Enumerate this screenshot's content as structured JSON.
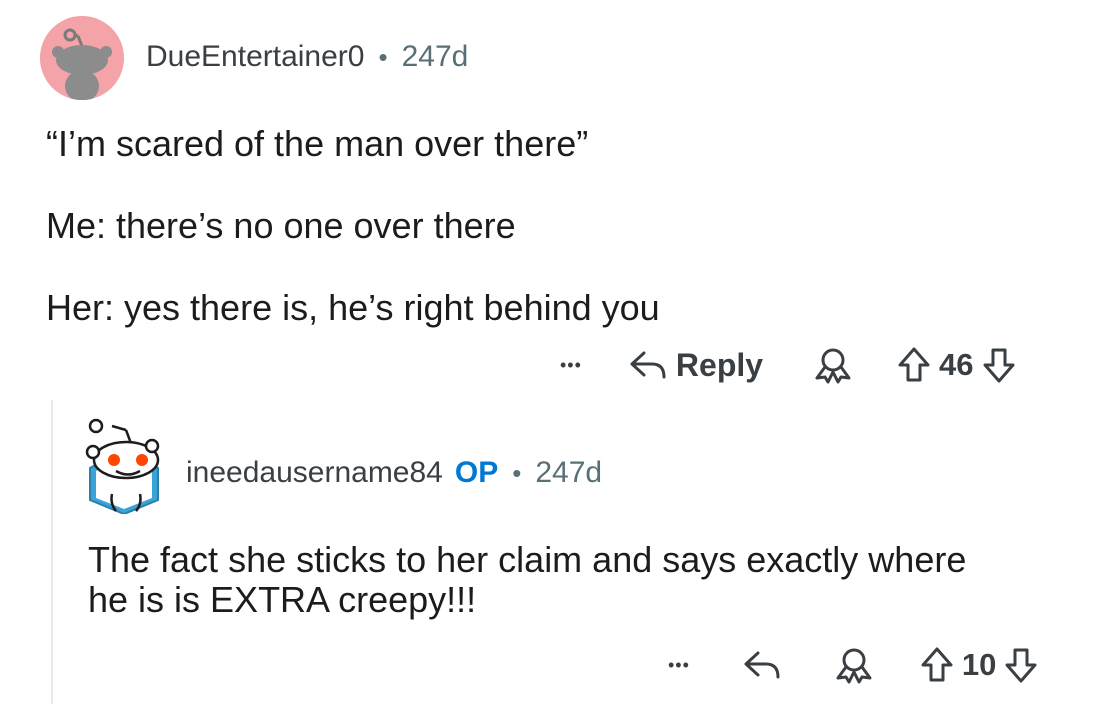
{
  "comments": [
    {
      "username": "DueEntertainer0",
      "separator": "•",
      "age": "247d",
      "body": [
        "“I’m scared of the man over there”",
        "Me: there’s no one over there",
        "Her: yes there is, he’s right behind you"
      ],
      "actions": {
        "more": "•••",
        "reply_label": "Reply",
        "score": "46"
      },
      "avatar": {
        "bg": "#f4a3a8",
        "icon": "snoo-avatar-icon"
      }
    },
    {
      "username": "ineedausername84",
      "op_badge": "OP",
      "separator": "•",
      "age": "247d",
      "body": [
        "The fact she sticks to her claim and says exactly where",
        "he is is EXTRA creepy!!!"
      ],
      "actions": {
        "more": "•••",
        "score": "10"
      },
      "avatar": {
        "bg": "#ffffff",
        "icon": "snoo-avatar-icon"
      }
    }
  ],
  "colors": {
    "meta": "#576f76",
    "op": "#0079d3",
    "text": "#1c1c1c",
    "thread_line": "#e5ebee"
  }
}
